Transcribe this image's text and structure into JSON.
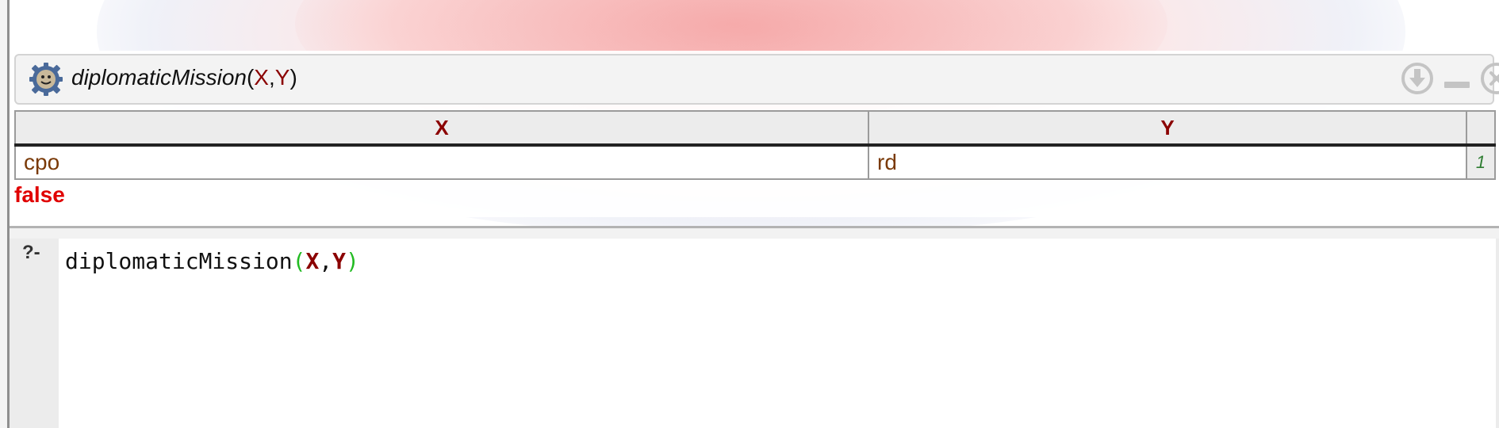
{
  "query": {
    "predicate": "diplomaticMission",
    "open_paren": "(",
    "var1": "X",
    "comma": ",",
    "var2": "Y",
    "close_paren": ")"
  },
  "results": {
    "columns": [
      "X",
      "Y"
    ],
    "rows": [
      {
        "X": "cpo",
        "Y": "rd",
        "index": "1"
      }
    ],
    "status": "false"
  },
  "editor": {
    "prompt": "?-",
    "predicate": "diplomaticMission",
    "open_paren": "(",
    "var1": "X",
    "comma": ",",
    "var2": "Y",
    "close_paren": ")"
  },
  "icons": {
    "gear": "gear-icon",
    "download": "download-icon",
    "minimize": "minimize-icon",
    "close": "close-icon"
  },
  "colors": {
    "variable": "#8b0000",
    "atom": "#7a3a08",
    "false_status": "#e00000",
    "paren": "#22bb22",
    "row_index": "#2e7d32"
  }
}
